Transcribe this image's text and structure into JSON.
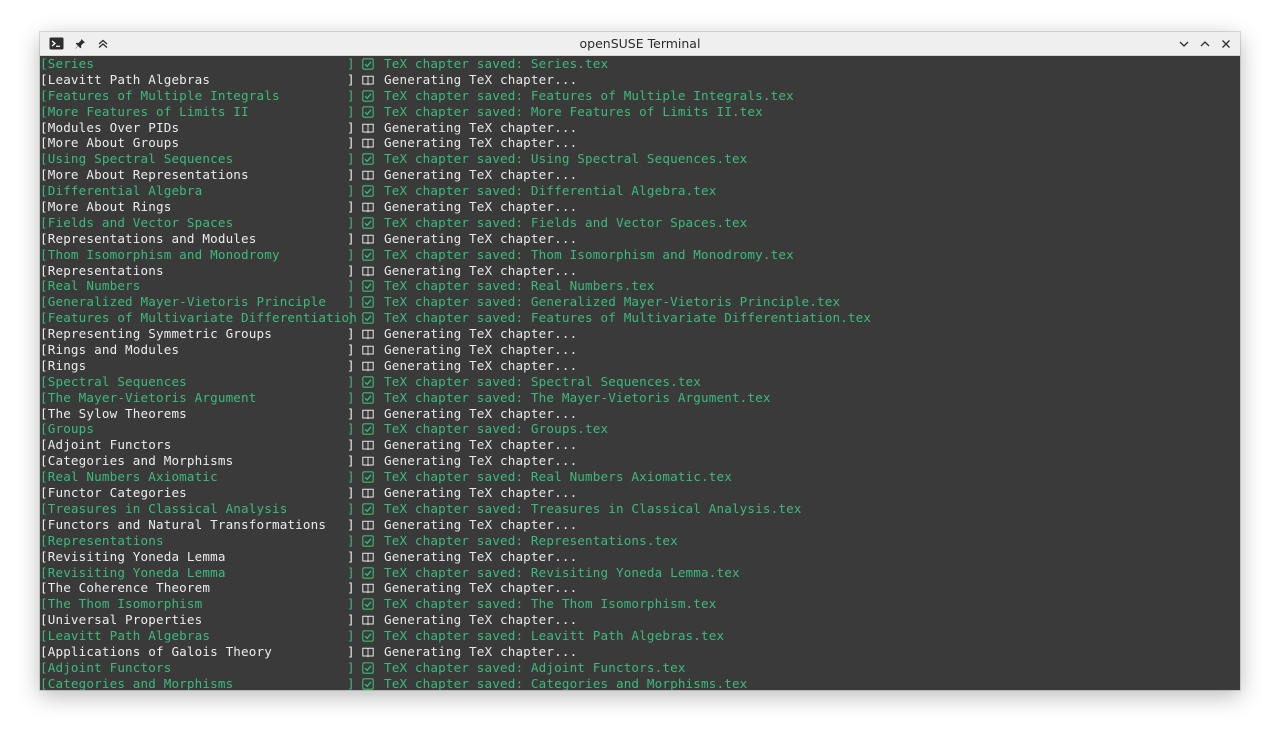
{
  "window": {
    "title": "openSUSE Terminal",
    "icons": [
      "terminal-icon",
      "pin-icon",
      "keep-above-icon",
      "minimize-icon",
      "maximize-icon",
      "close-icon"
    ]
  },
  "colors": {
    "saved": "#3dba7a",
    "generating": "#e8e8e8",
    "background": "#3a3a3a"
  },
  "lines": [
    {
      "status": "saved",
      "name": "[Series",
      "bracket": "]",
      "icon": "checkbox-icon",
      "message": "TeX chapter saved: Series.tex"
    },
    {
      "status": "generating",
      "name": "[Leavitt Path Algebras",
      "bracket": "]",
      "icon": "book-icon",
      "message": "Generating TeX chapter..."
    },
    {
      "status": "saved",
      "name": "[Features of Multiple Integrals",
      "bracket": "]",
      "icon": "checkbox-icon",
      "message": "TeX chapter saved: Features of Multiple Integrals.tex"
    },
    {
      "status": "saved",
      "name": "[More Features of Limits II",
      "bracket": "]",
      "icon": "checkbox-icon",
      "message": "TeX chapter saved: More Features of Limits II.tex"
    },
    {
      "status": "generating",
      "name": "[Modules Over PIDs",
      "bracket": "]",
      "icon": "book-icon",
      "message": "Generating TeX chapter..."
    },
    {
      "status": "generating",
      "name": "[More About Groups",
      "bracket": "]",
      "icon": "book-icon",
      "message": "Generating TeX chapter..."
    },
    {
      "status": "saved",
      "name": "[Using Spectral Sequences",
      "bracket": "]",
      "icon": "checkbox-icon",
      "message": "TeX chapter saved: Using Spectral Sequences.tex"
    },
    {
      "status": "generating",
      "name": "[More About Representations",
      "bracket": "]",
      "icon": "book-icon",
      "message": "Generating TeX chapter..."
    },
    {
      "status": "saved",
      "name": "[Differential Algebra",
      "bracket": "]",
      "icon": "checkbox-icon",
      "message": "TeX chapter saved: Differential Algebra.tex"
    },
    {
      "status": "generating",
      "name": "[More About Rings",
      "bracket": "]",
      "icon": "book-icon",
      "message": "Generating TeX chapter..."
    },
    {
      "status": "saved",
      "name": "[Fields and Vector Spaces",
      "bracket": "]",
      "icon": "checkbox-icon",
      "message": "TeX chapter saved: Fields and Vector Spaces.tex"
    },
    {
      "status": "generating",
      "name": "[Representations and Modules",
      "bracket": "]",
      "icon": "book-icon",
      "message": "Generating TeX chapter..."
    },
    {
      "status": "saved",
      "name": "[Thom Isomorphism and Monodromy",
      "bracket": "]",
      "icon": "checkbox-icon",
      "message": "TeX chapter saved: Thom Isomorphism and Monodromy.tex"
    },
    {
      "status": "generating",
      "name": "[Representations",
      "bracket": "]",
      "icon": "book-icon",
      "message": "Generating TeX chapter..."
    },
    {
      "status": "saved",
      "name": "[Real Numbers",
      "bracket": "]",
      "icon": "checkbox-icon",
      "message": "TeX chapter saved: Real Numbers.tex"
    },
    {
      "status": "saved",
      "name": "[Generalized Mayer-Vietoris Principle",
      "bracket": "]",
      "icon": "checkbox-icon",
      "message": "TeX chapter saved: Generalized Mayer-Vietoris Principle.tex"
    },
    {
      "status": "saved",
      "name": "[Features of Multivariate Differentiation",
      "bracket": "]",
      "icon": "checkbox-icon",
      "message": "TeX chapter saved: Features of Multivariate Differentiation.tex"
    },
    {
      "status": "generating",
      "name": "[Representing Symmetric Groups",
      "bracket": "]",
      "icon": "book-icon",
      "message": "Generating TeX chapter..."
    },
    {
      "status": "generating",
      "name": "[Rings and Modules",
      "bracket": "]",
      "icon": "book-icon",
      "message": "Generating TeX chapter..."
    },
    {
      "status": "generating",
      "name": "[Rings",
      "bracket": "]",
      "icon": "book-icon",
      "message": "Generating TeX chapter..."
    },
    {
      "status": "saved",
      "name": "[Spectral Sequences",
      "bracket": "]",
      "icon": "checkbox-icon",
      "message": "TeX chapter saved: Spectral Sequences.tex"
    },
    {
      "status": "saved",
      "name": "[The Mayer-Vietoris Argument",
      "bracket": "]",
      "icon": "checkbox-icon",
      "message": "TeX chapter saved: The Mayer-Vietoris Argument.tex"
    },
    {
      "status": "generating",
      "name": "[The Sylow Theorems",
      "bracket": "]",
      "icon": "book-icon",
      "message": "Generating TeX chapter..."
    },
    {
      "status": "saved",
      "name": "[Groups",
      "bracket": "]",
      "icon": "checkbox-icon",
      "message": "TeX chapter saved: Groups.tex"
    },
    {
      "status": "generating",
      "name": "[Adjoint Functors",
      "bracket": "]",
      "icon": "book-icon",
      "message": "Generating TeX chapter..."
    },
    {
      "status": "generating",
      "name": "[Categories and Morphisms",
      "bracket": "]",
      "icon": "book-icon",
      "message": "Generating TeX chapter..."
    },
    {
      "status": "saved",
      "name": "[Real Numbers Axiomatic",
      "bracket": "]",
      "icon": "checkbox-icon",
      "message": "TeX chapter saved: Real Numbers Axiomatic.tex"
    },
    {
      "status": "generating",
      "name": "[Functor Categories",
      "bracket": "]",
      "icon": "book-icon",
      "message": "Generating TeX chapter..."
    },
    {
      "status": "saved",
      "name": "[Treasures in Classical Analysis",
      "bracket": "]",
      "icon": "checkbox-icon",
      "message": "TeX chapter saved: Treasures in Classical Analysis.tex"
    },
    {
      "status": "generating",
      "name": "[Functors and Natural Transformations",
      "bracket": "]",
      "icon": "book-icon",
      "message": "Generating TeX chapter..."
    },
    {
      "status": "saved",
      "name": "[Representations",
      "bracket": "]",
      "icon": "checkbox-icon",
      "message": "TeX chapter saved: Representations.tex"
    },
    {
      "status": "generating",
      "name": "[Revisiting Yoneda Lemma",
      "bracket": "]",
      "icon": "book-icon",
      "message": "Generating TeX chapter..."
    },
    {
      "status": "saved",
      "name": "[Revisiting Yoneda Lemma",
      "bracket": "]",
      "icon": "checkbox-icon",
      "message": "TeX chapter saved: Revisiting Yoneda Lemma.tex"
    },
    {
      "status": "generating",
      "name": "[The Coherence Theorem",
      "bracket": "]",
      "icon": "book-icon",
      "message": "Generating TeX chapter..."
    },
    {
      "status": "saved",
      "name": "[The Thom Isomorphism",
      "bracket": "]",
      "icon": "checkbox-icon",
      "message": "TeX chapter saved: The Thom Isomorphism.tex"
    },
    {
      "status": "generating",
      "name": "[Universal Properties",
      "bracket": "]",
      "icon": "book-icon",
      "message": "Generating TeX chapter..."
    },
    {
      "status": "saved",
      "name": "[Leavitt Path Algebras",
      "bracket": "]",
      "icon": "checkbox-icon",
      "message": "TeX chapter saved: Leavitt Path Algebras.tex"
    },
    {
      "status": "generating",
      "name": "[Applications of Galois Theory",
      "bracket": "]",
      "icon": "book-icon",
      "message": "Generating TeX chapter..."
    },
    {
      "status": "saved",
      "name": "[Adjoint Functors",
      "bracket": "]",
      "icon": "checkbox-icon",
      "message": "TeX chapter saved: Adjoint Functors.tex"
    },
    {
      "status": "saved",
      "name": "[Categories and Morphisms",
      "bracket": "]",
      "icon": "checkbox-icon",
      "message": "TeX chapter saved: Categories and Morphisms.tex"
    }
  ]
}
